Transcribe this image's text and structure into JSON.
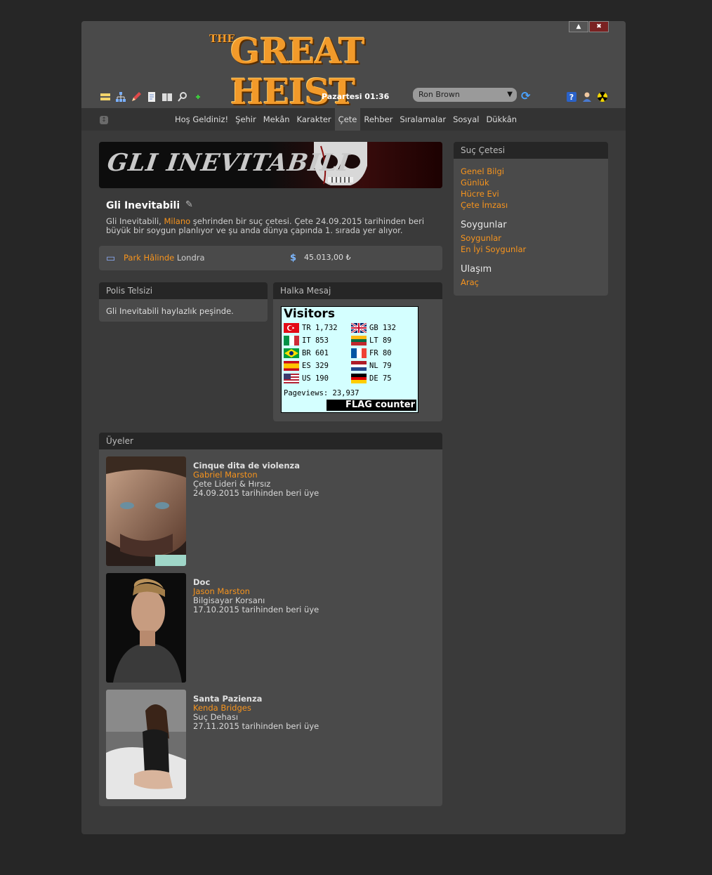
{
  "window": {
    "minimize_label": "▲",
    "close_label": "✖"
  },
  "header": {
    "logo_small": "THE",
    "logo_main": "GREAT HEIST",
    "clock": "Pazartesi 01:36",
    "character": "Ron Brown",
    "toolbar_icons": [
      "notes-icon",
      "hierarchy-icon",
      "pencil-icon",
      "document-icon",
      "book-icon",
      "magnifier-icon",
      "plus-icon"
    ],
    "right_icons": [
      "help-icon",
      "user-icon",
      "radiation-icon"
    ]
  },
  "nav": {
    "items": [
      "Hoş Geldiniz!",
      "Şehir",
      "Mekân",
      "Karakter",
      "Çete",
      "Rehber",
      "Sıralamalar",
      "Sosyal",
      "Dükkân"
    ],
    "active": "Çete"
  },
  "banner": {
    "text": "GLI INEVITABILI"
  },
  "gang": {
    "name": "Gli Inevitabili",
    "desc_prefix": "Gli Inevitabili, ",
    "city": "Milano",
    "desc_rest": " şehrinden bir suç çetesi. Çete 24.09.2015 tarihinden beri büyük bir soygun planlıyor ve şu anda dünya çapında 1. sırada yer alıyor."
  },
  "info": {
    "status_link": "Park Hâlinde",
    "location": " Londra",
    "money": "45.013,00 ₺"
  },
  "police": {
    "title": "Polis Telsizi",
    "text": "Gli Inevitabili haylazlık peşinde."
  },
  "public_message": {
    "title": "Halka Mesaj"
  },
  "visitors": {
    "title": "Visitors",
    "left": [
      {
        "code": "TR",
        "count": "1,732"
      },
      {
        "code": "IT",
        "count": "853"
      },
      {
        "code": "BR",
        "count": "601"
      },
      {
        "code": "ES",
        "count": "329"
      },
      {
        "code": "US",
        "count": "190"
      }
    ],
    "right": [
      {
        "code": "GB",
        "count": "132"
      },
      {
        "code": "LT",
        "count": "89"
      },
      {
        "code": "FR",
        "count": "80"
      },
      {
        "code": "NL",
        "count": "79"
      },
      {
        "code": "DE",
        "count": "75"
      }
    ],
    "pageviews": "Pageviews: 23,937",
    "badge": "FLAG counter"
  },
  "members": {
    "title": "Üyeler",
    "list": [
      {
        "nick": "Cinque dita de violenza",
        "name": "Gabriel Marston",
        "role": "Çete Lideri & Hırsız",
        "since": "24.09.2015 tarihinden beri üye"
      },
      {
        "nick": "Doc",
        "name": "Jason Marston",
        "role": "Bilgisayar Korsanı",
        "since": "17.10.2015 tarihinden beri üye"
      },
      {
        "nick": "Santa Pazienza",
        "name": "Kenda Bridges",
        "role": "Suç Dehası",
        "since": "27.11.2015 tarihinden beri üye"
      }
    ]
  },
  "sidebar": {
    "title": "Suç Çetesi",
    "links1": [
      "Genel Bilgi",
      "Günlük",
      "Hücre Evi",
      "Çete İmzası"
    ],
    "heading2": "Soygunlar",
    "links2": [
      "Soygunlar",
      "En İyi Soygunlar"
    ],
    "heading3": "Ulaşım",
    "links3": [
      "Araç"
    ]
  },
  "colors": {
    "accent": "#f7941d",
    "background": "#262626",
    "panel": "#4a4a4a",
    "window": "#3a3a3a"
  }
}
